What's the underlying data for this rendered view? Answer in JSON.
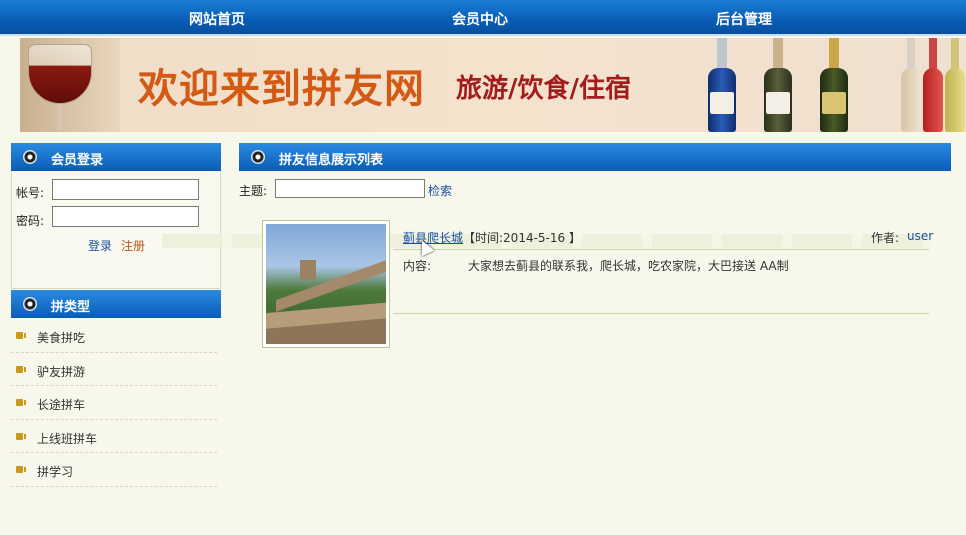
{
  "nav": {
    "home": "网站首页",
    "member": "会员中心",
    "admin": "后台管理"
  },
  "banner": {
    "title": "欢迎来到拼友网",
    "subtitle": "旅游/饮食/住宿"
  },
  "login": {
    "header": "会员登录",
    "account_label": "帐号:",
    "password_label": "密码:",
    "account_value": "",
    "password_value": "",
    "login_link": "登录",
    "register_link": "注册"
  },
  "categories": {
    "header": "拼类型",
    "items": [
      {
        "label": "美食拼吃"
      },
      {
        "label": "驴友拼游"
      },
      {
        "label": "长途拼车"
      },
      {
        "label": "上线班拼车"
      },
      {
        "label": "拼学习"
      }
    ]
  },
  "main": {
    "header": "拼友信息展示列表",
    "search_label": "主题:",
    "search_value": "",
    "search_button": "检索",
    "posts": [
      {
        "title": "蓟县爬长城",
        "time": "【时间:2014-5-16 】",
        "author_label": "作者:",
        "author": "user",
        "content_label": "内容:",
        "content": "大家想去蓟县的联系我，爬长城，吃农家院，大巴接送 AA制"
      }
    ]
  },
  "colors": {
    "nav_blue": "#0a5cb6",
    "link_blue": "#1a4fa0",
    "banner_title": "#d35a14",
    "banner_sub": "#a31d1d"
  }
}
